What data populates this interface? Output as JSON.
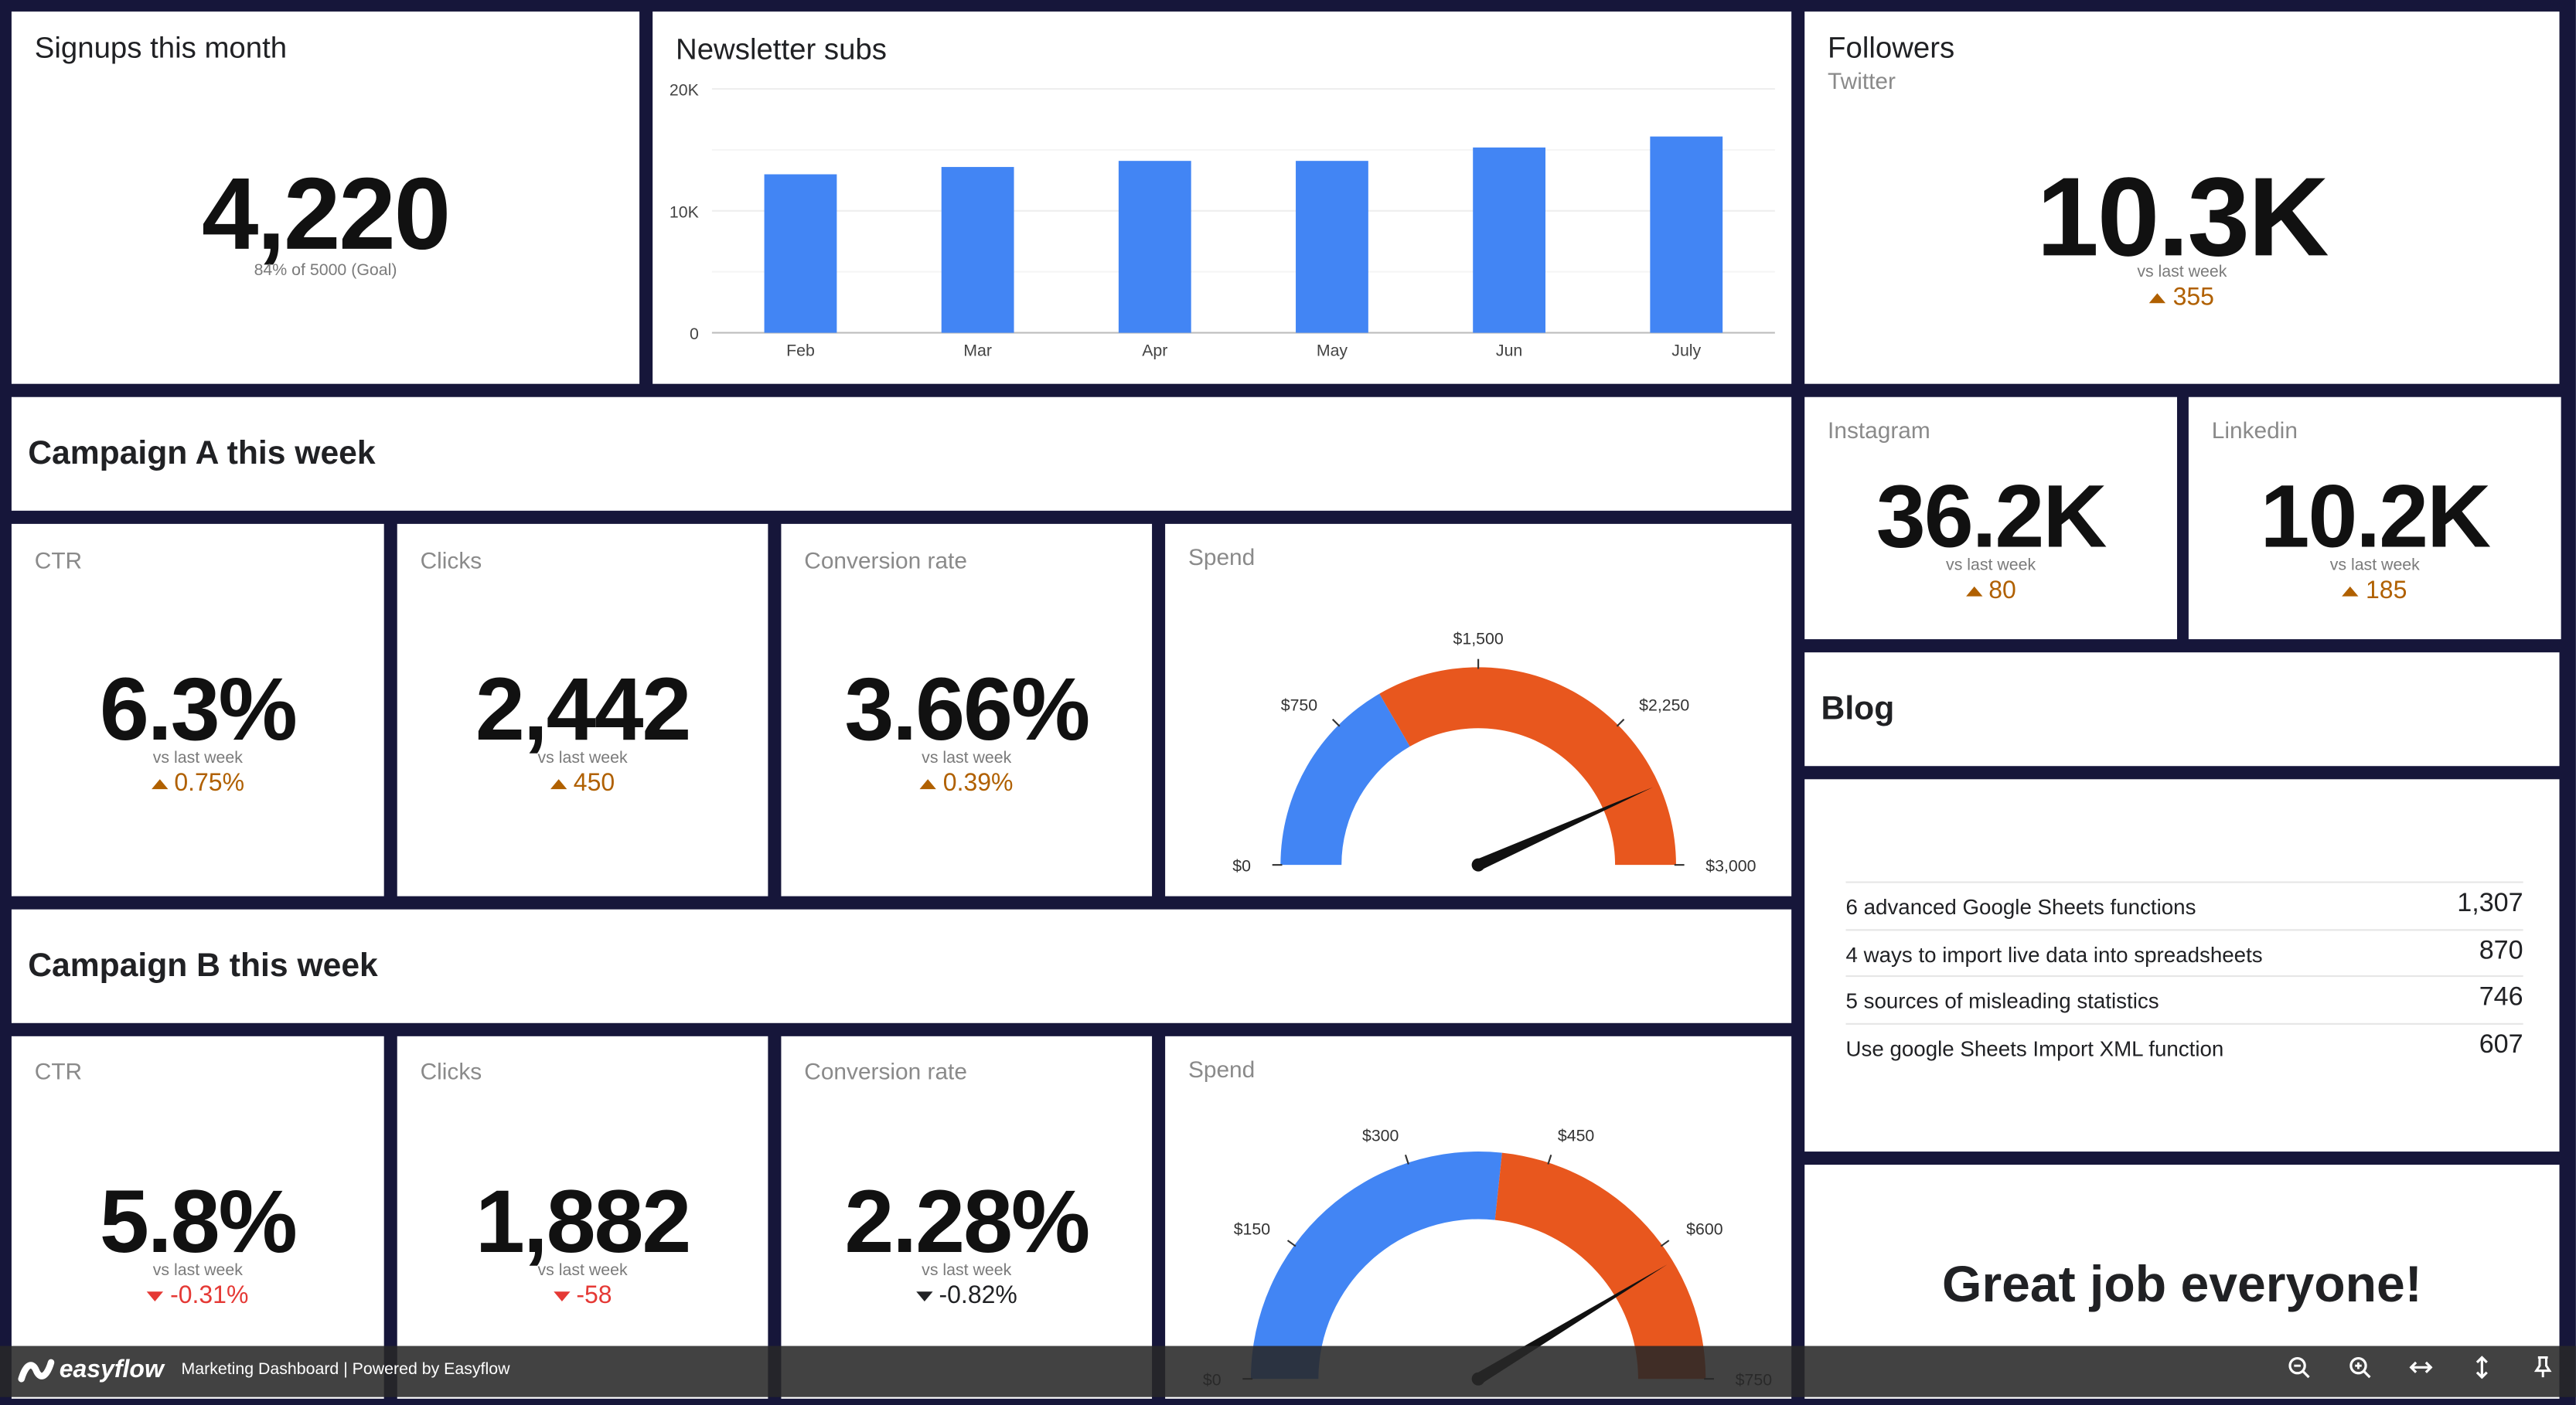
{
  "signups": {
    "title": "Signups this month",
    "value": "4,220",
    "subtitle": "84% of 5000 (Goal)"
  },
  "newsletter": {
    "title": "Newsletter subs"
  },
  "chart_data": {
    "type": "bar",
    "title": "Newsletter subs",
    "categories": [
      "Feb",
      "Mar",
      "Apr",
      "May",
      "Jun",
      "July"
    ],
    "values": [
      13000,
      13600,
      14100,
      14100,
      15200,
      16100
    ],
    "y_ticks": [
      "0",
      "10K",
      "20K"
    ],
    "ylim": [
      0,
      20000
    ],
    "color": "#4285f4",
    "grid": true
  },
  "followers": {
    "title": "Followers",
    "platform": "Twitter",
    "value": "10.3K",
    "vs": "vs last week",
    "delta": "355"
  },
  "instagram": {
    "label": "Instagram",
    "value": "36.2K",
    "vs": "vs last week",
    "delta": "80"
  },
  "linkedin": {
    "label": "Linkedin",
    "value": "10.2K",
    "vs": "vs last week",
    "delta": "185"
  },
  "campaign_a": {
    "header": "Campaign A this week",
    "ctr": {
      "label": "CTR",
      "value": "6.3%",
      "vs": "vs last week",
      "delta": "0.75%"
    },
    "clicks": {
      "label": "Clicks",
      "value": "2,442",
      "vs": "vs last week",
      "delta": "450"
    },
    "conversion": {
      "label": "Conversion rate",
      "value": "3.66%",
      "vs": "vs last week",
      "delta": "0.39%"
    },
    "spend": {
      "label": "Spend",
      "min": 0,
      "max": 3000,
      "threshold": 1000,
      "value": 2600,
      "ticks": [
        "$0",
        "$750",
        "$1,500",
        "$2,250",
        "$3,000"
      ],
      "colors": {
        "low": "#4285f4",
        "high": "#e8571e"
      }
    }
  },
  "campaign_b": {
    "header": "Campaign B this week",
    "ctr": {
      "label": "CTR",
      "value": "5.8%",
      "vs": "vs last week",
      "delta": "-0.31%"
    },
    "clicks": {
      "label": "Clicks",
      "value": "1,882",
      "vs": "vs last week",
      "delta": "-58"
    },
    "conversion": {
      "label": "Conversion rate",
      "value": "2.28%",
      "vs": "vs last week",
      "delta": "-0.82%"
    },
    "spend": {
      "label": "Spend",
      "min": 0,
      "max": 750,
      "threshold": 400,
      "value": 620,
      "ticks": [
        "$0",
        "$150",
        "$300",
        "$450",
        "$600",
        "$750"
      ],
      "colors": {
        "low": "#4285f4",
        "high": "#e8571e"
      }
    }
  },
  "blog": {
    "header": "Blog",
    "rows": [
      {
        "title": "6 advanced Google Sheets functions",
        "views": "1,307"
      },
      {
        "title": "4 ways to import live data into spreadsheets",
        "views": "870"
      },
      {
        "title": "5 sources of misleading statistics",
        "views": "746"
      },
      {
        "title": "Use google Sheets Import XML function",
        "views": "607"
      }
    ]
  },
  "message": {
    "text": "Great job everyone!"
  },
  "footer": {
    "brand": "easyflow",
    "caption": "Marketing Dashboard | Powered by Easyflow",
    "icons": [
      "zoom-out-icon",
      "zoom-in-icon",
      "fit-width-icon",
      "fit-height-icon",
      "pin-icon"
    ]
  },
  "colors": {
    "background": "#16163a",
    "accent_blue": "#4285f4",
    "accent_orange": "#e8571e",
    "up": "#b06000",
    "down": "#e53935"
  }
}
